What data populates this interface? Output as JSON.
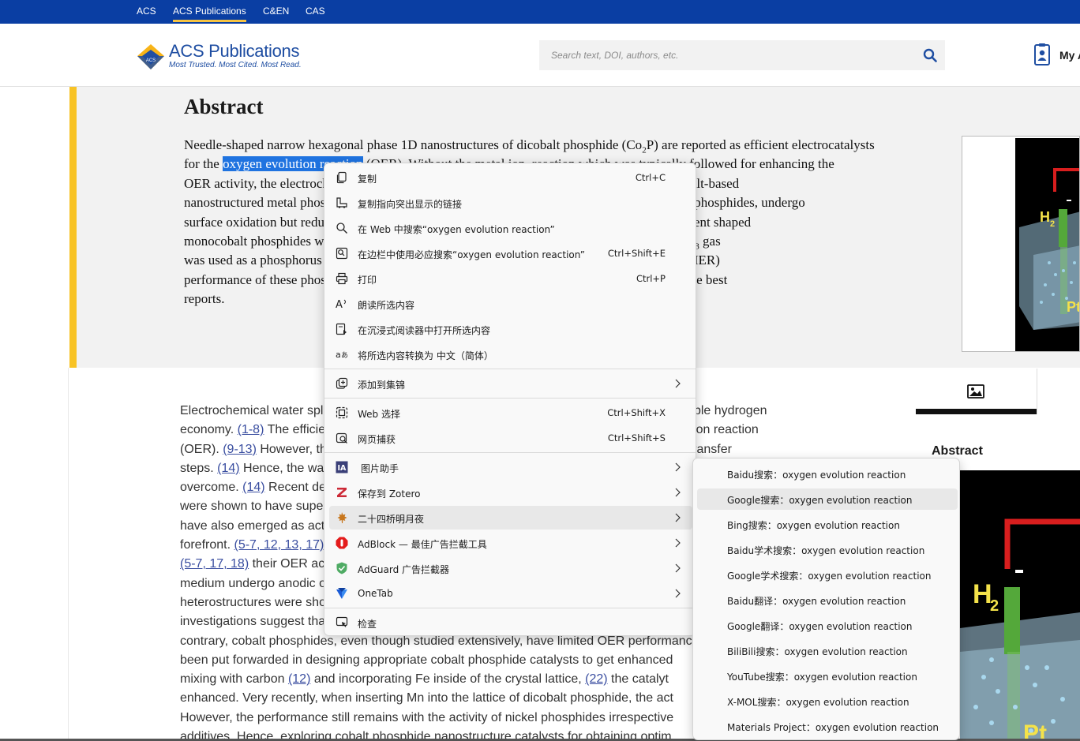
{
  "topnav": {
    "items": [
      {
        "label": "ACS"
      },
      {
        "label": "ACS Publications",
        "active": true
      },
      {
        "label": "C&EN"
      },
      {
        "label": "CAS"
      }
    ]
  },
  "header": {
    "logo_text": "ACS Publications",
    "logo_tagline": "Most Trusted. Most Cited. Most Read.",
    "search_placeholder": "Search text, DOI, authors, etc.",
    "account_label": "My A"
  },
  "abstract": {
    "title": "Abstract",
    "lines": [
      {
        "pre": "Needle-shaped narrow hexagonal phase 1D nanostructures of dicobalt phosphide (Co",
        "sub": "2",
        "post": "P) are reported as efficient electrocatalysts"
      },
      {
        "pre": "for the ",
        "selected": "oxygen evolution reaction",
        "post": " (OER). Without the metal ion, reaction which was typically followed for enhancing the"
      },
      {
        "text": "OER activity, the electrochemical surface was oxidized and the comparison to all reported cobalt-based"
      },
      {
        "text": "nanostructured metal phosphides was made, as we found that similar to the like all other metal phosphides, undergo"
      },
      {
        "text": "surface oxidation but reduced interaction with the phosphide lattice and surface-oxidized different shaped"
      },
      {
        "pre": "monocobalt phosphides was established by employing a moderate synthetic protocol where PH",
        "sub": "3",
        "post": " gas"
      },
      {
        "text": "was used as a phosphorus source and the catalysts evaluated for hydrogen evolution reaction (HER)"
      },
      {
        "text": "performance of these phosphides was also investigated and found to be comparable to that in the best"
      },
      {
        "text": "reports."
      }
    ]
  },
  "body": {
    "lines": [
      {
        "segs": [
          {
            "t": "Electrochemical water splitting is considered as one of the most promising routes for a possible hydrogen"
          }
        ]
      },
      {
        "segs": [
          {
            "t": "economy. "
          },
          {
            "l": "(1-8)"
          },
          {
            "t": " The efficiency of water splitting is largely limited by the anodic oxygen evolution reaction"
          }
        ]
      },
      {
        "segs": [
          {
            "t": "(OER). "
          },
          {
            "l": "(9-13)"
          },
          {
            "t": " However, the OER involves a complicated four-step proton-coupled electron-transfer"
          }
        ]
      },
      {
        "segs": [
          {
            "t": "steps. "
          },
          {
            "l": "(14)"
          },
          {
            "t": " Hence, the water splitting has a sluggish kinetics that is to overcome."
          }
        ]
      },
      {
        "segs": [
          {
            "t": "overcome. "
          },
          {
            "l": "(14)"
          },
          {
            "t": " Recent developments in the field of metal phosphides"
          }
        ]
      },
      {
        "segs": [
          {
            "t": "were shown to have superior catalytic activity in the field of HER"
          }
        ]
      },
      {
        "segs": [
          {
            "t": "have also emerged as active catalysts in the field of OER at the"
          }
        ]
      },
      {
        "segs": [
          {
            "t": "forefront. "
          },
          {
            "l": "(5-7, 12, 13, 17)"
          },
          {
            "t": " Various metal phosphides reported"
          }
        ]
      },
      {
        "segs": [
          {
            "l": "(5-7, 17, 18)"
          },
          {
            "t": " their OER activities are comparable, and in alkaline"
          }
        ]
      },
      {
        "segs": [
          {
            "t": "medium undergo anodic oxidation to form metal oxides/hydroxides"
          }
        ]
      },
      {
        "segs": [
          {
            "t": "heterostructures were shown to act as the active sites, and"
          }
        ]
      },
      {
        "segs": [
          {
            "t": "investigations suggest that the metal phosphide is a pre-catalyst"
          }
        ]
      },
      {
        "segs": [
          {
            "t": "contrary, cobalt phosphides, even though studied extensively, have limited OER performance"
          }
        ]
      },
      {
        "segs": [
          {
            "t": "been put forwarded in designing appropriate cobalt phosphide catalysts to get enhanced"
          }
        ]
      },
      {
        "segs": [
          {
            "t": "mixing with carbon "
          },
          {
            "l": "(12)"
          },
          {
            "t": " and incorporating Fe inside of the crystal lattice, "
          },
          {
            "l": "(22)"
          },
          {
            "t": " the catalyt"
          }
        ]
      },
      {
        "segs": [
          {
            "t": "enhanced. Very recently, when inserting Mn into the lattice of dicobalt phosphide, the act"
          }
        ]
      },
      {
        "segs": [
          {
            "t": "However, the performance still remains with the activity of nickel phosphides irrespective"
          }
        ]
      },
      {
        "segs": [
          {
            "t": "additives. Hence, exploring cobalt phosphide nanostructure catalysts for obtaining optim"
          }
        ]
      }
    ]
  },
  "right_panel": {
    "abstract_label": "Abstract",
    "graphic_labels": {
      "h2": "H",
      "h2_sub": "2",
      "pt": "Pt"
    }
  },
  "context_menu": {
    "items": [
      {
        "icon": "copy-icon",
        "label": "复制",
        "shortcut": "Ctrl+C"
      },
      {
        "icon": "copy-link-icon",
        "label": "复制指向突出显示的链接"
      },
      {
        "icon": "search-icon",
        "label": "在 Web 中搜索“oxygen evolution reaction”"
      },
      {
        "icon": "sidebar-search-icon",
        "label": "在边栏中使用必应搜索“oxygen evolution reaction”",
        "shortcut": "Ctrl+Shift+E"
      },
      {
        "icon": "print-icon",
        "label": "打印",
        "shortcut": "Ctrl+P"
      },
      {
        "icon": "read-aloud-icon",
        "label": "朗读所选内容"
      },
      {
        "icon": "immersive-reader-icon",
        "label": "在沉浸式阅读器中打开所选内容"
      },
      {
        "icon": "translate-icon",
        "label": "将所选内容转换为 中文（简体）"
      },
      {
        "icon": "collections-icon",
        "label": "添加到集锦",
        "submenu": true
      },
      {
        "icon": "web-select-icon",
        "label": "Web 选择",
        "shortcut": "Ctrl+Shift+X"
      },
      {
        "icon": "web-capture-icon",
        "label": "网页捕获",
        "shortcut": "Ctrl+Shift+S"
      },
      {
        "icon": "image-assistant-icon",
        "label": "图片助手",
        "submenu": true
      },
      {
        "icon": "zotero-icon",
        "label": "保存到 Zotero",
        "submenu": true
      },
      {
        "icon": "maple-leaf-icon",
        "label": "二十四桥明月夜",
        "submenu": true,
        "hover": true
      },
      {
        "icon": "adblock-icon",
        "label": "AdBlock — 最佳广告拦截工具",
        "submenu": true
      },
      {
        "icon": "adguard-icon",
        "label": "AdGuard 广告拦截器",
        "submenu": true
      },
      {
        "icon": "onetab-icon",
        "label": "OneTab",
        "submenu": true
      },
      {
        "icon": "inspect-icon",
        "label": "检查"
      }
    ]
  },
  "submenu": {
    "items": [
      {
        "label": "Baidu搜索：oxygen evolution reaction"
      },
      {
        "label": "Google搜索：oxygen evolution reaction",
        "hover": true
      },
      {
        "label": "Bing搜索：oxygen evolution reaction"
      },
      {
        "label": "Baidu学术搜索：oxygen evolution reaction"
      },
      {
        "label": "Google学术搜索：oxygen evolution reaction"
      },
      {
        "label": "Baidu翻译：oxygen evolution reaction"
      },
      {
        "label": "Google翻译：oxygen evolution reaction"
      },
      {
        "label": "BiliBili搜索：oxygen evolution reaction"
      },
      {
        "label": "YouTube搜索：oxygen evolution reaction"
      },
      {
        "label": "X-MOL搜索：oxygen evolution reaction"
      },
      {
        "label": "Materials Project：oxygen evolution reaction"
      }
    ]
  },
  "colors": {
    "topbar": "#0a3ea3",
    "accent_yellow": "#f8c325",
    "selection": "#1f73e0",
    "link": "#3a4ea0"
  }
}
